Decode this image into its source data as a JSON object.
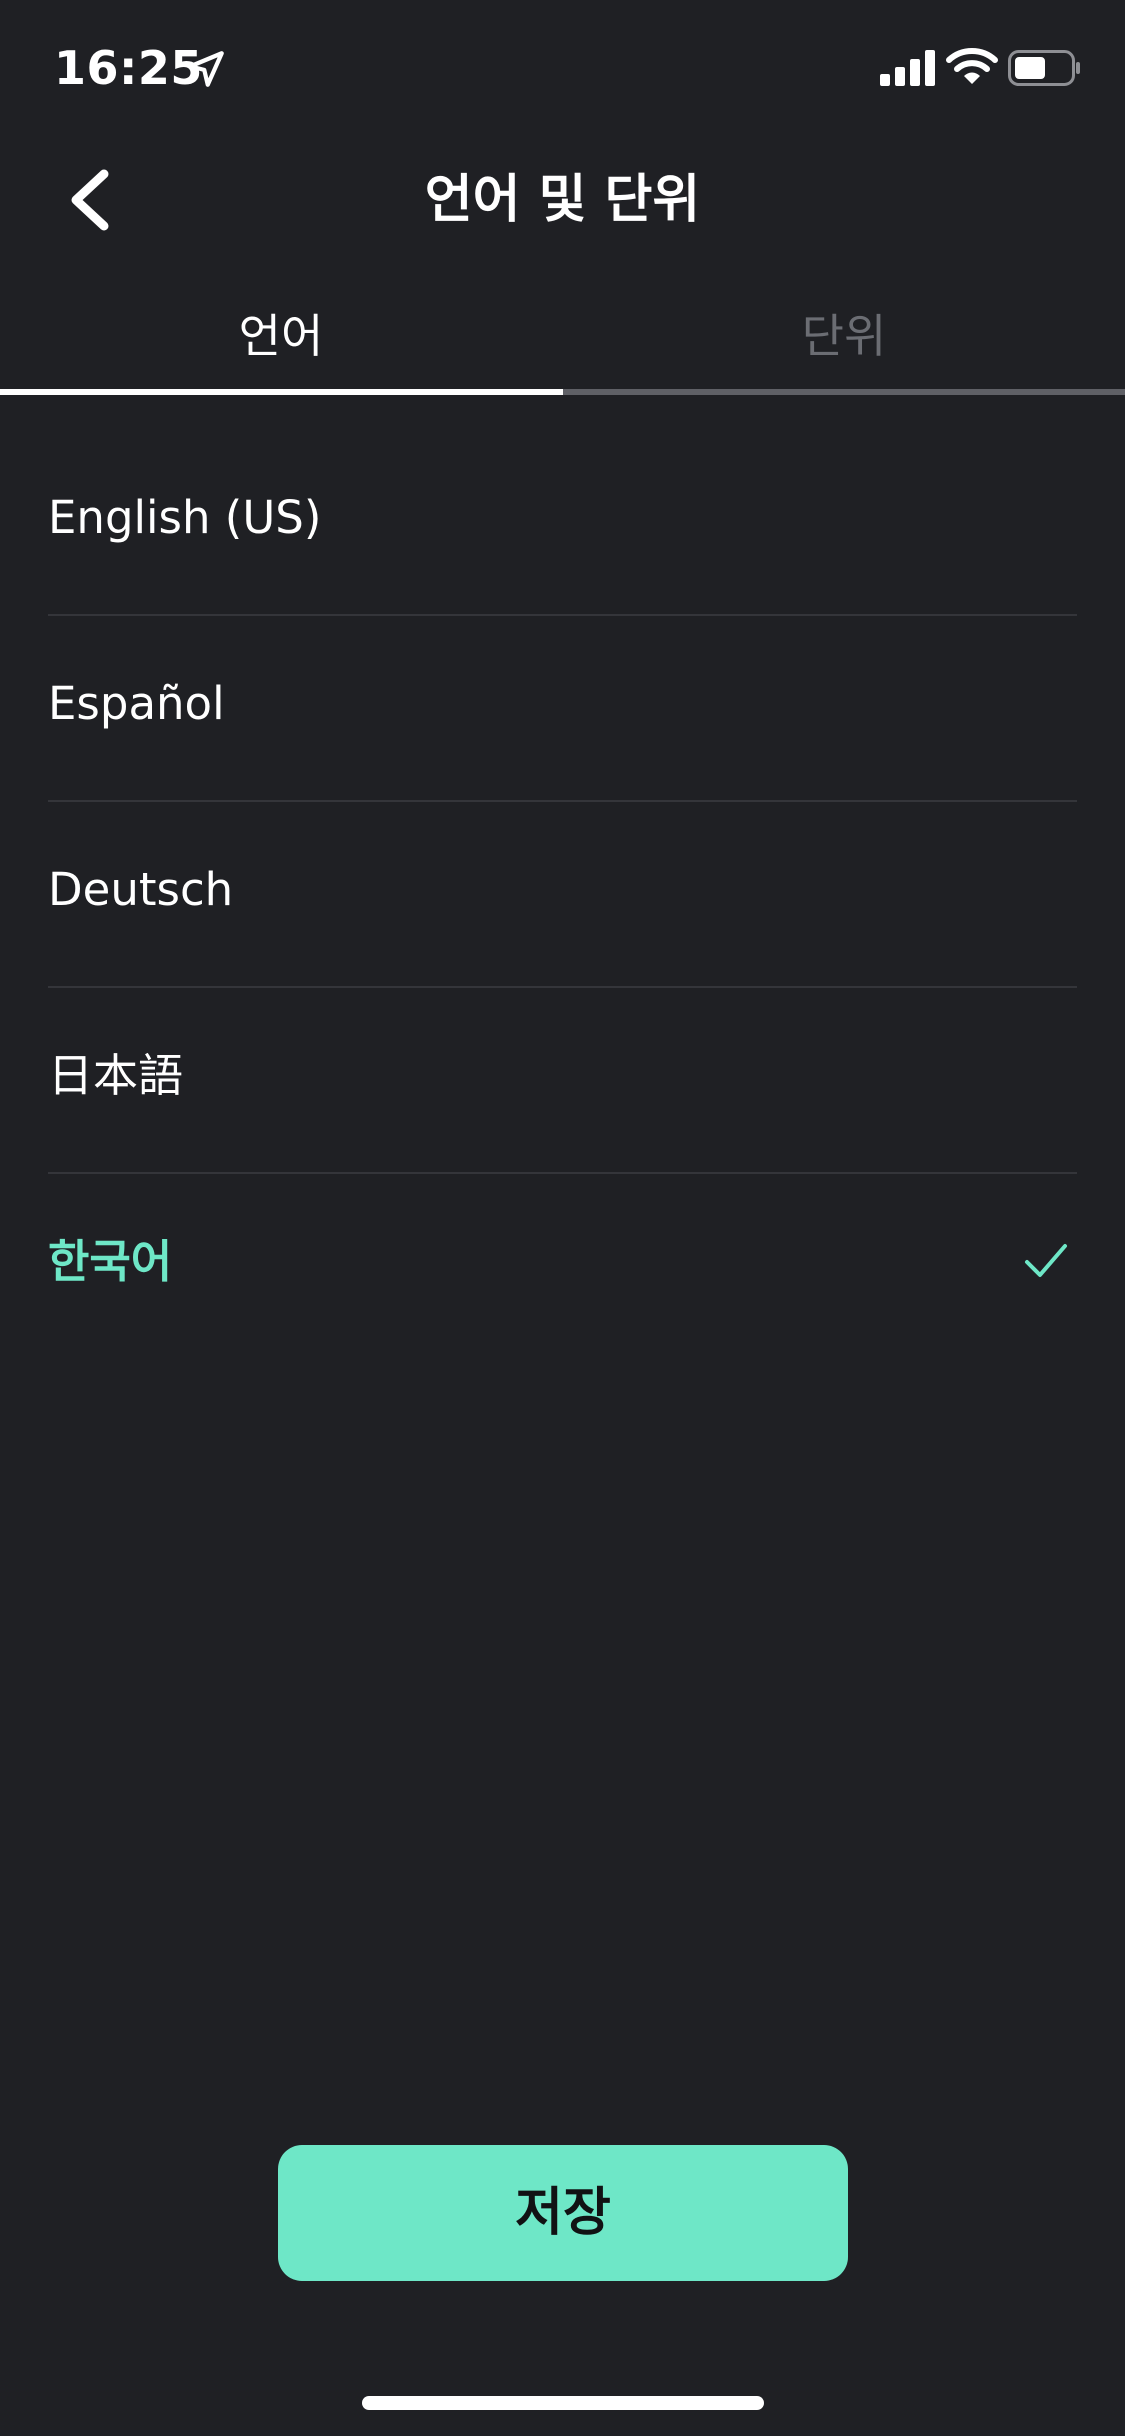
{
  "status_bar": {
    "time": "16:25",
    "icons": [
      "location-arrow-icon",
      "cellular-signal-icon",
      "wifi-icon",
      "battery-icon"
    ]
  },
  "header": {
    "title": "언어 및 단위",
    "back_icon": "chevron-left-icon"
  },
  "tabs": [
    {
      "label": "언어",
      "active": true
    },
    {
      "label": "단위",
      "active": false
    }
  ],
  "languages": [
    {
      "label": "English (US)",
      "selected": false
    },
    {
      "label": "Español",
      "selected": false
    },
    {
      "label": "Deutsch",
      "selected": false
    },
    {
      "label": "日本語",
      "selected": false
    },
    {
      "label": "한국어",
      "selected": true
    }
  ],
  "save_button": {
    "label": "저장"
  },
  "colors": {
    "background": "#1f2024",
    "accent": "#6ee7c7",
    "divider": "#34353a",
    "inactive_tab": "#6b6d73"
  }
}
